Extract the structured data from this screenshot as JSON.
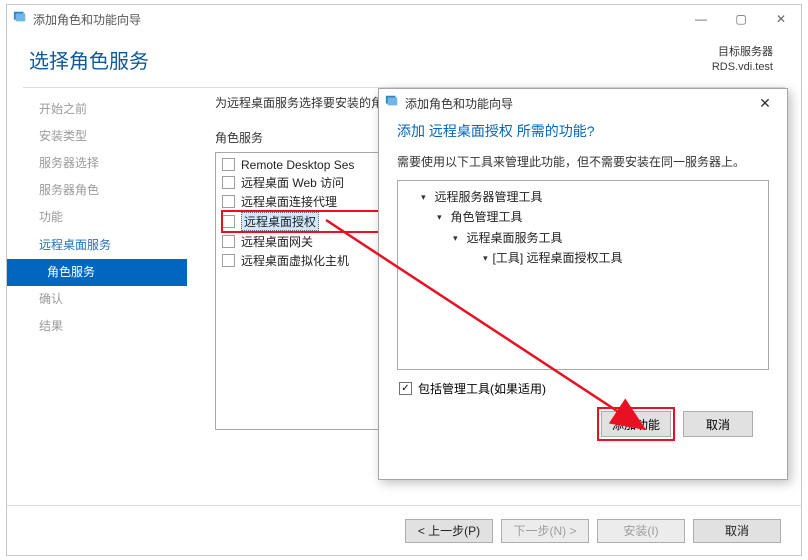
{
  "main": {
    "title": "添加角色和功能向导",
    "page_title": "选择角色服务",
    "target_label": "目标服务器",
    "target_value": "RDS.vdi.test",
    "hint": "为远程桌面服务选择要安装的角色服务",
    "group_label": "角色服务"
  },
  "nav": {
    "before": "开始之前",
    "type": "安装类型",
    "server_sel": "服务器选择",
    "server_role": "服务器角色",
    "features": "功能",
    "rds": "远程桌面服务",
    "role_svc": "角色服务",
    "confirm": "确认",
    "results": "结果"
  },
  "role_services": [
    "Remote Desktop Ses",
    "远程桌面 Web 访问",
    "远程桌面连接代理",
    "远程桌面授权",
    "远程桌面网关",
    "远程桌面虚拟化主机"
  ],
  "footer": {
    "prev": "< 上一步(P)",
    "next": "下一步(N) >",
    "install": "安装(I)",
    "cancel": "取消"
  },
  "dialog": {
    "title": "添加角色和功能向导",
    "heading": "添加 远程桌面授权 所需的功能?",
    "desc": "需要使用以下工具来管理此功能，但不需要安装在同一服务器上。",
    "include_label": "包括管理工具(如果适用)",
    "include_checked": "✓",
    "add": "添加功能",
    "cancel": "取消",
    "tree": {
      "n1": "远程服务器管理工具",
      "n2": "角色管理工具",
      "n3": "远程桌面服务工具",
      "n4": "[工具] 远程桌面授权工具"
    }
  }
}
